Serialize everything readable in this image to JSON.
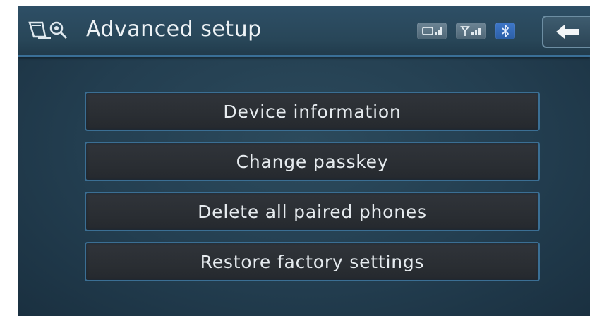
{
  "header": {
    "title": "Advanced setup",
    "app_icon": "phone-settings-icon",
    "status_icons": [
      "phone-signal-icon",
      "network-signal-icon",
      "bluetooth-icon"
    ],
    "back_icon": "back-arrow-icon"
  },
  "menu": {
    "items": [
      {
        "label": "Device information"
      },
      {
        "label": "Change passkey"
      },
      {
        "label": "Delete all paired phones"
      },
      {
        "label": "Restore factory settings"
      }
    ]
  },
  "colors": {
    "background": "#233e50",
    "header": "#2e4f66",
    "accent_border": "#3b6f94",
    "button_fill": "#2b2f34",
    "text": "#e6ebef",
    "bluetooth": "#2b5ea6"
  }
}
